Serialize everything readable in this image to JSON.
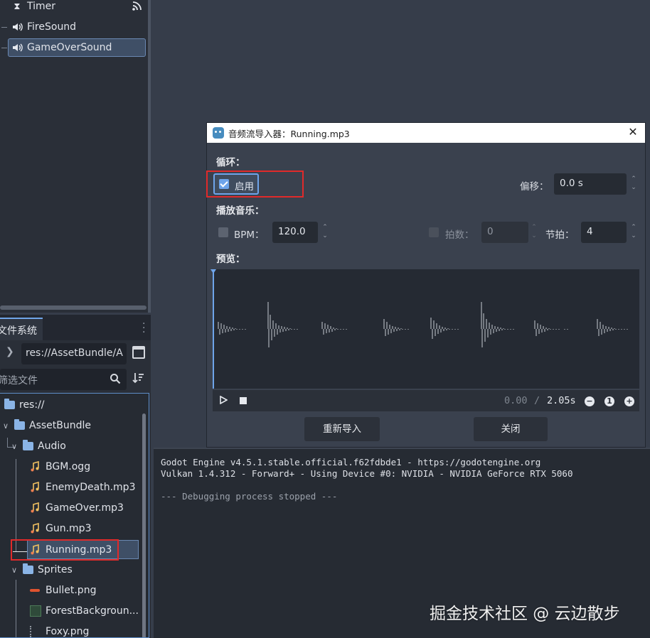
{
  "scene_tree": {
    "items": [
      {
        "label": "Timer",
        "icon": "hourglass-icon"
      },
      {
        "label": "FireSound",
        "icon": "speaker-icon"
      },
      {
        "label": "GameOverSound",
        "icon": "speaker-icon",
        "selected": true
      }
    ],
    "signal_icon": "signal-icon"
  },
  "filesystem": {
    "tab_label": "文件系统",
    "path": "res://AssetBundle/A",
    "filter_placeholder": "筛选文件",
    "tree": [
      {
        "label": "res://",
        "type": "folder"
      },
      {
        "label": "AssetBundle",
        "type": "folder"
      },
      {
        "label": "Audio",
        "type": "folder"
      },
      {
        "label": "BGM.ogg",
        "type": "audio"
      },
      {
        "label": "EnemyDeath.mp3",
        "type": "audio"
      },
      {
        "label": "GameOver.mp3",
        "type": "audio"
      },
      {
        "label": "Gun.mp3",
        "type": "audio"
      },
      {
        "label": "Running.mp3",
        "type": "audio",
        "selected": true
      },
      {
        "label": "Sprites",
        "type": "folder"
      },
      {
        "label": "Bullet.png",
        "type": "image"
      },
      {
        "label": "ForestBackgroun...",
        "type": "image"
      },
      {
        "label": "Foxy.png",
        "type": "image"
      }
    ]
  },
  "dialog": {
    "title": "音频流导入器：Running.mp3",
    "loop_section": "循环：",
    "loop_enable_label": "启用",
    "loop_enabled": true,
    "offset_label": "偏移：",
    "offset_value": "0.0 s",
    "music_section": "播放音乐：",
    "bpm_label": "BPM：",
    "bpm_enabled": false,
    "bpm_value": "120.0",
    "beats_label": "拍数：",
    "beats_value": "0",
    "bar_beats_label": "节拍：",
    "bar_beats_value": "4",
    "preview_label": "预览：",
    "time_current": "0.00",
    "time_separator": "/",
    "time_total": "2.05s",
    "reimport_button": "重新导入",
    "close_button": "关闭",
    "accent_color": "#6ea4ea"
  },
  "log": {
    "lines": [
      "Godot Engine v4.5.1.stable.official.f62fdbde1 - https://godotengine.org",
      "Vulkan 1.4.312 - Forward+ - Using Device #0: NVIDIA - NVIDIA GeForce RTX 5060",
      "--- Debugging process stopped ---"
    ]
  },
  "watermark": "掘金技术社区 @ 云边散步"
}
